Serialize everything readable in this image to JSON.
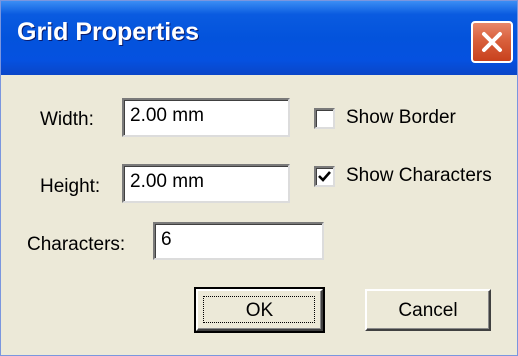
{
  "window": {
    "title": "Grid Properties",
    "close_icon": "close-icon"
  },
  "fields": {
    "width_label": "Width:",
    "width_value": "2.00 mm",
    "height_label": "Height:",
    "height_value": "2.00 mm",
    "characters_label": "Characters:",
    "characters_value": "6"
  },
  "options": {
    "show_border_label": "Show Border",
    "show_border_checked": false,
    "show_characters_label": "Show Characters",
    "show_characters_checked": true
  },
  "buttons": {
    "ok_label": "OK",
    "cancel_label": "Cancel"
  },
  "colors": {
    "titlebar": "#0353DC",
    "dialog_background": "#ECE9D8",
    "close_button": "#D9603C"
  }
}
